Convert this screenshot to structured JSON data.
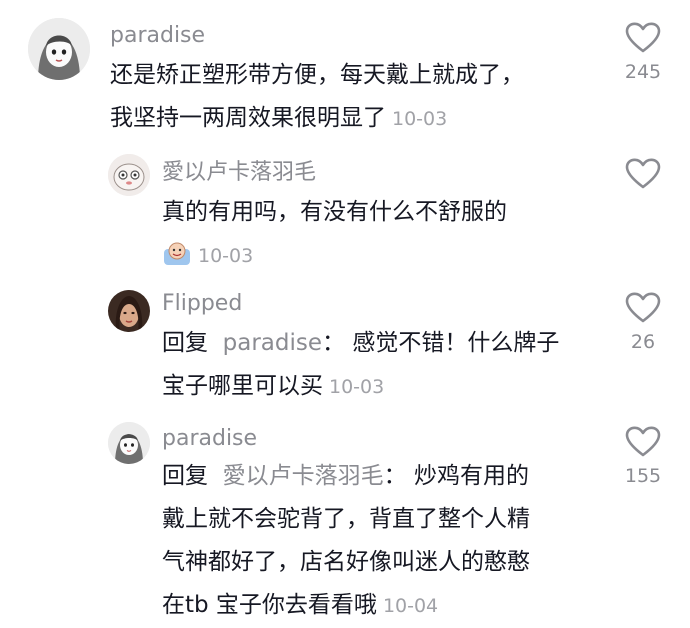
{
  "comments": [
    {
      "username": "paradise",
      "lines": [
        "还是矫正塑形带方便，每天戴上就成了，",
        "我坚持一两周效果很明显了"
      ],
      "time": "10-03",
      "likes": "245"
    },
    {
      "username": "愛以卢卡落羽毛",
      "lines": [
        "真的有用吗，有没有什么不舒服的"
      ],
      "time": "10-03",
      "likes": ""
    },
    {
      "username": "Flipped",
      "reply_prefix": "回复",
      "mention": "paradise",
      "separator": "：",
      "lines": [
        "感觉不错！什么牌子",
        "宝子哪里可以买"
      ],
      "time": "10-03",
      "likes": "26"
    },
    {
      "username": "paradise",
      "reply_prefix": "回复",
      "mention": "愛以卢卡落羽毛",
      "separator": "：",
      "lines": [
        "炒鸡有用的",
        "戴上就不会驼背了，背直了整个人精",
        "气神都好了，店名好像叫迷人的憨憨",
        "在tb 宝子你去看看哦"
      ],
      "time": "10-04",
      "likes": "155"
    }
  ],
  "icons": {
    "like": "heart-outline-icon",
    "emoji": "grinning-sticker-emoji"
  },
  "colors": {
    "text": "#161823",
    "username": "#8a8b91",
    "timestamp": "#a1a2a7",
    "heart": "#8a8b91"
  }
}
